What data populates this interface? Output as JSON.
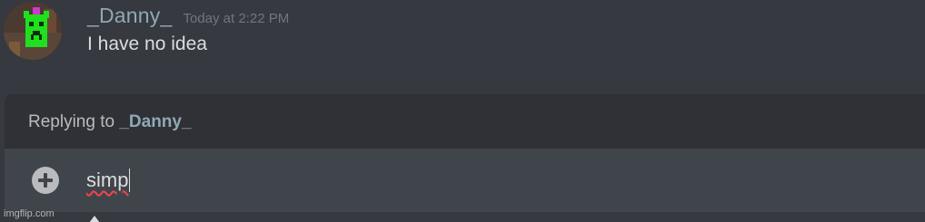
{
  "message": {
    "avatar_icon": "pixel-creeper-avatar",
    "username": "_Danny_",
    "timestamp": "Today at 2:22 PM",
    "content": "I have no idea"
  },
  "reply": {
    "prefix": "Replying to ",
    "target_name": "_Danny_"
  },
  "composer": {
    "add_icon": "plus-circle-icon",
    "current_value": "simp"
  },
  "watermark": "imgflip.com",
  "colors": {
    "background": "#36393f",
    "reply_bar": "#2f3136",
    "composer": "#40444b",
    "username": "#8fa9b4",
    "spellcheck": "#f04747"
  }
}
